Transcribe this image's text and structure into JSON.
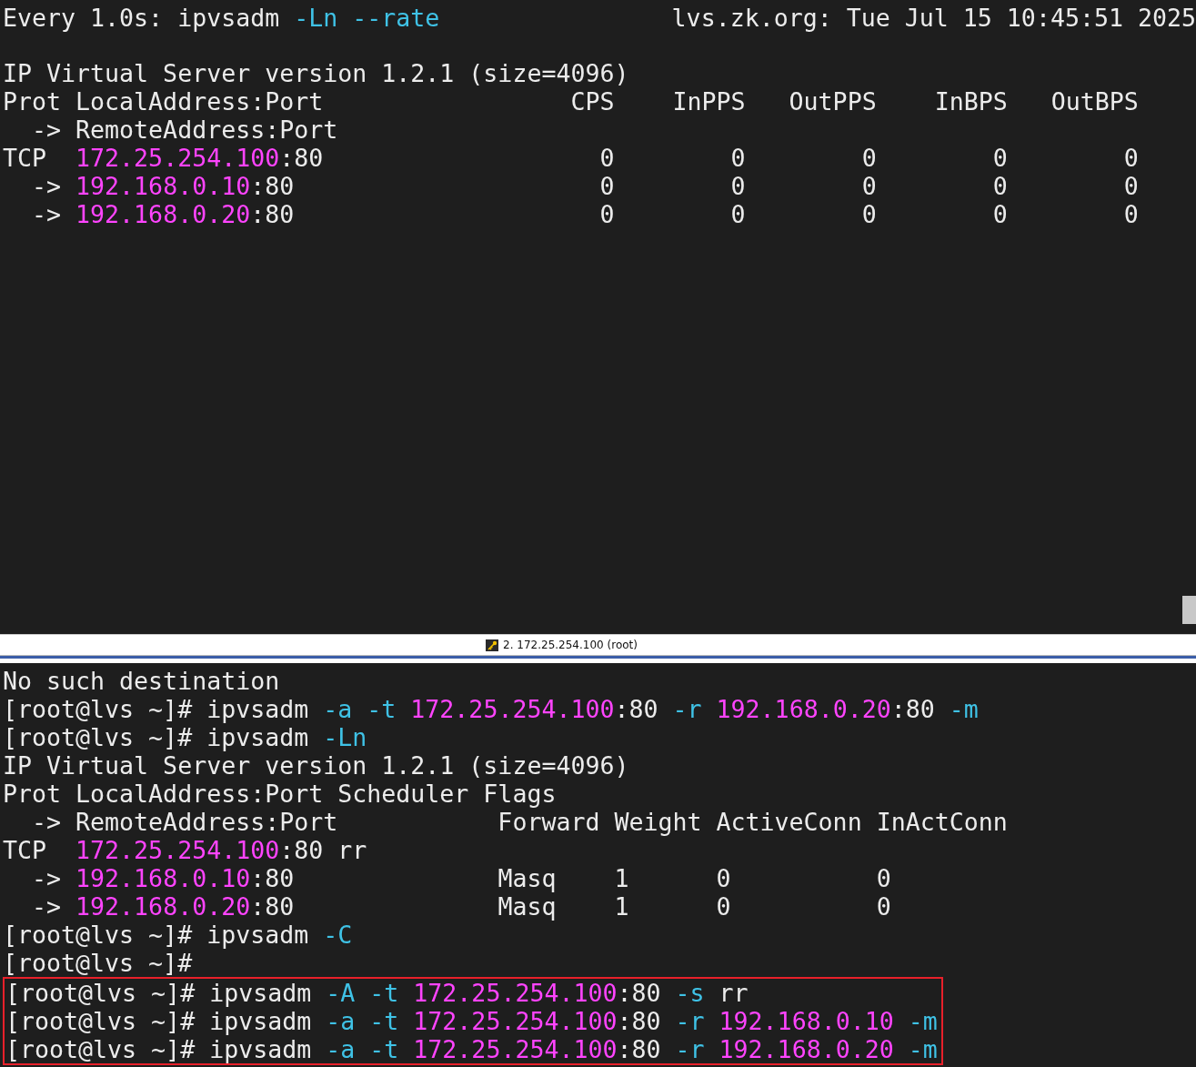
{
  "top_pane": {
    "status_line": {
      "left": [
        {
          "kind": "text",
          "text": "Every 1.0s: ipvsadm "
        },
        {
          "kind": "flag",
          "text": "-Ln --rate"
        }
      ],
      "right": "lvs.zk.org: Tue Jul 15 10:45:51 2025"
    },
    "lines": [
      [
        {
          "kind": "text",
          "text": "IP Virtual Server version 1.2.1 (size=4096)"
        }
      ],
      [
        {
          "kind": "text",
          "text": "Prot LocalAddress:Port                 CPS    InPPS   OutPPS    InBPS   OutBPS"
        }
      ],
      [
        {
          "kind": "text",
          "text": "  -> RemoteAddress:Port"
        }
      ],
      [
        {
          "kind": "text",
          "text": "TCP  "
        },
        {
          "kind": "addr",
          "text": "172.25.254.100"
        },
        {
          "kind": "text",
          "text": ":80                   0        0        0        0        0"
        }
      ],
      [
        {
          "kind": "text",
          "text": "  -> "
        },
        {
          "kind": "addr",
          "text": "192.168.0.10"
        },
        {
          "kind": "text",
          "text": ":80                     0        0        0        0        0"
        }
      ],
      [
        {
          "kind": "text",
          "text": "  -> "
        },
        {
          "kind": "addr",
          "text": "192.168.0.20"
        },
        {
          "kind": "text",
          "text": ":80                     0        0        0        0        0"
        }
      ]
    ]
  },
  "divider": {
    "title": "2. 172.25.254.100 (root)"
  },
  "bottom_pane": {
    "lines": [
      [
        {
          "kind": "text",
          "text": "No such destination"
        }
      ],
      [
        {
          "kind": "text",
          "text": "[root@lvs ~]# ipvsadm "
        },
        {
          "kind": "flag",
          "text": "-a -t "
        },
        {
          "kind": "addr",
          "text": "172.25.254.100"
        },
        {
          "kind": "text",
          "text": ":80 "
        },
        {
          "kind": "flag",
          "text": "-r "
        },
        {
          "kind": "addr",
          "text": "192.168.0.20"
        },
        {
          "kind": "text",
          "text": ":80 "
        },
        {
          "kind": "flag",
          "text": "-m"
        }
      ],
      [
        {
          "kind": "text",
          "text": "[root@lvs ~]# ipvsadm "
        },
        {
          "kind": "flag",
          "text": "-Ln"
        }
      ],
      [
        {
          "kind": "text",
          "text": "IP Virtual Server version 1.2.1 (size=4096)"
        }
      ],
      [
        {
          "kind": "text",
          "text": "Prot LocalAddress:Port Scheduler Flags"
        }
      ],
      [
        {
          "kind": "text",
          "text": "  -> RemoteAddress:Port           Forward Weight ActiveConn InActConn"
        }
      ],
      [
        {
          "kind": "text",
          "text": "TCP  "
        },
        {
          "kind": "addr",
          "text": "172.25.254.100"
        },
        {
          "kind": "text",
          "text": ":80 rr"
        }
      ],
      [
        {
          "kind": "text",
          "text": "  -> "
        },
        {
          "kind": "addr",
          "text": "192.168.0.10"
        },
        {
          "kind": "text",
          "text": ":80              Masq    1      0          0"
        }
      ],
      [
        {
          "kind": "text",
          "text": "  -> "
        },
        {
          "kind": "addr",
          "text": "192.168.0.20"
        },
        {
          "kind": "text",
          "text": ":80              Masq    1      0          0"
        }
      ],
      [
        {
          "kind": "text",
          "text": "[root@lvs ~]# ipvsadm "
        },
        {
          "kind": "flag",
          "text": "-C"
        }
      ],
      [
        {
          "kind": "text",
          "text": "[root@lvs ~]#"
        }
      ]
    ],
    "highlighted_lines": [
      [
        {
          "kind": "text",
          "text": "[root@lvs ~]# ipvsadm "
        },
        {
          "kind": "flag",
          "text": "-A -t "
        },
        {
          "kind": "addr",
          "text": "172.25.254.100"
        },
        {
          "kind": "text",
          "text": ":80 "
        },
        {
          "kind": "flag",
          "text": "-s"
        },
        {
          "kind": "text",
          "text": " rr"
        }
      ],
      [
        {
          "kind": "text",
          "text": "[root@lvs ~]# ipvsadm "
        },
        {
          "kind": "flag",
          "text": "-a -t "
        },
        {
          "kind": "addr",
          "text": "172.25.254.100"
        },
        {
          "kind": "text",
          "text": ":80 "
        },
        {
          "kind": "flag",
          "text": "-r "
        },
        {
          "kind": "addr",
          "text": "192.168.0.10"
        },
        {
          "kind": "flag",
          "text": " -m"
        }
      ],
      [
        {
          "kind": "text",
          "text": "[root@lvs ~]# ipvsadm "
        },
        {
          "kind": "flag",
          "text": "-a -t "
        },
        {
          "kind": "addr",
          "text": "172.25.254.100"
        },
        {
          "kind": "text",
          "text": ":80 "
        },
        {
          "kind": "flag",
          "text": "-r "
        },
        {
          "kind": "addr",
          "text": "192.168.0.20"
        },
        {
          "kind": "flag",
          "text": " -m"
        }
      ]
    ]
  }
}
